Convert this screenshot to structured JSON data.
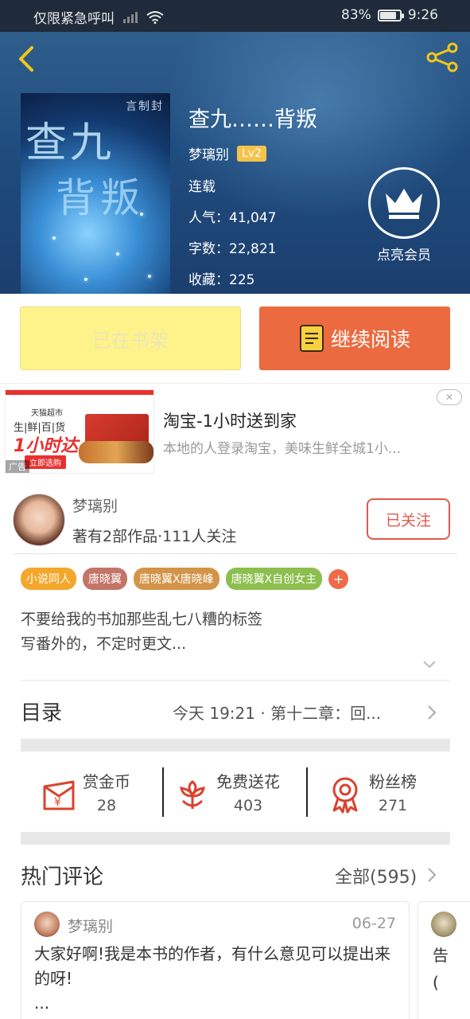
{
  "status_bar": {
    "carrier": "仅限紧急呼叫",
    "battery": "83%",
    "battery_level": 0.83,
    "time": "9:26"
  },
  "book": {
    "title": "查九……背叛",
    "author": "梦璃别",
    "level": "Lv2",
    "status": "连载",
    "popularity_label": "人气：",
    "popularity": "41,047",
    "words_label": "字数：",
    "words": "22,821",
    "favorites_label": "收藏：",
    "favorites": "225",
    "cover_title_top": "查九",
    "cover_title_bottom": "背叛",
    "cover_corner": "言制封"
  },
  "vip": {
    "label": "点亮会员"
  },
  "actions": {
    "shelf": "已在书架",
    "read": "继续阅读"
  },
  "ad": {
    "title": "淘宝-1小时送到家",
    "description": "本地的人登录淘宝，美味生鲜全城1小...",
    "image_brand": "天猫超市",
    "image_category": "生|鲜|百|货",
    "image_headline": "1小时达",
    "image_button": "立即选购",
    "image_tag": "广告"
  },
  "author_panel": {
    "name": "梦璃别",
    "stats": "著有2部作品·111人关注",
    "follow": "已关注",
    "tags": [
      {
        "label": "小说同人",
        "color": "#f3a72b"
      },
      {
        "label": "唐晓翼",
        "color": "#c47468"
      },
      {
        "label": "唐晓翼X唐晓峰",
        "color": "#d39448"
      },
      {
        "label": "唐晓翼X自创女主",
        "color": "#8cbf4e"
      }
    ],
    "tag_add": "+",
    "description_lines": [
      "不要给我的书加那些乱七八糟的标签",
      "写番外的，不定时更文..."
    ]
  },
  "toc": {
    "title": "目录",
    "latest": "今天 19:21 · 第十二章：回..."
  },
  "stats": [
    {
      "label": "赏金币",
      "value": "28",
      "icon": "coin-envelope-icon"
    },
    {
      "label": "免费送花",
      "value": "403",
      "icon": "flower-icon"
    },
    {
      "label": "粉丝榜",
      "value": "271",
      "icon": "medal-icon"
    }
  ],
  "comments": {
    "title": "热门评论",
    "all": "全部(595)",
    "items": [
      {
        "user": "梦璃别",
        "date": "06-27",
        "text": "大家好啊!我是本书的作者，有什么意见可以提出来的呀!",
        "more": "..."
      }
    ],
    "peek_text": "告",
    "peek_text2": "("
  },
  "colors": {
    "accent": "#ec6a3f",
    "shelf": "#fef38a",
    "follow": "#e0584f",
    "hero": "#1f4c7e"
  }
}
